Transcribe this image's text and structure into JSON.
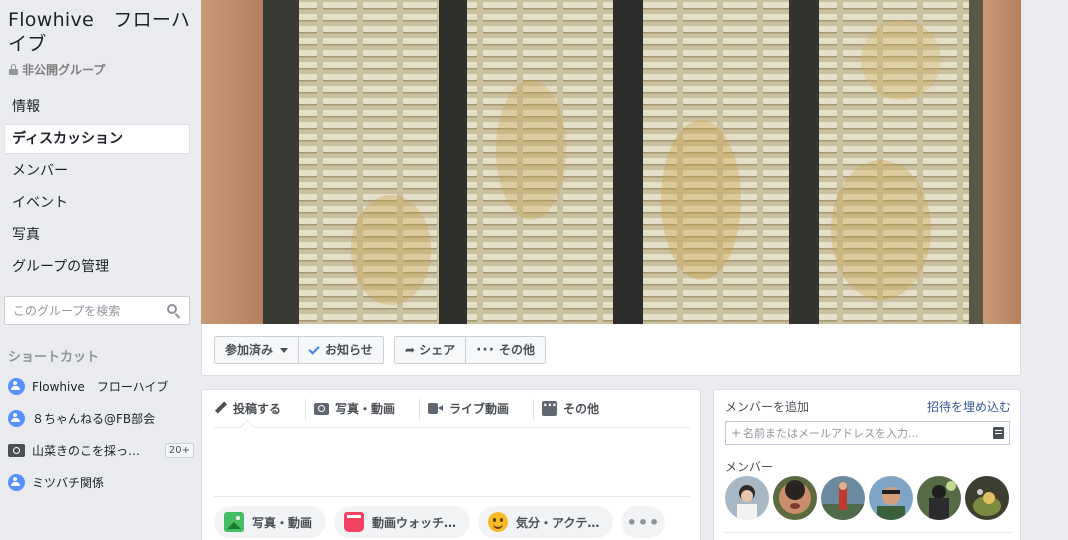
{
  "group": {
    "title": "Flowhive　フローハイブ",
    "privacy": "非公開グループ"
  },
  "nav": {
    "items": [
      {
        "label": "情報"
      },
      {
        "label": "ディスカッション"
      },
      {
        "label": "メンバー"
      },
      {
        "label": "イベント"
      },
      {
        "label": "写真"
      },
      {
        "label": "グループの管理"
      }
    ]
  },
  "search": {
    "placeholder": "このグループを検索"
  },
  "shortcuts": {
    "title": "ショートカット",
    "items": [
      {
        "label": "Flowhive　フローハイブ",
        "icon": "group-icon"
      },
      {
        "label": "８ちゃんねる@FB部会",
        "icon": "group-icon"
      },
      {
        "label": "山菜きのこを採っ…",
        "icon": "camera-icon",
        "badge": "20+"
      },
      {
        "label": "ミツバチ関係",
        "icon": "group-icon"
      }
    ]
  },
  "actions": {
    "joined": "参加済み",
    "notifications": "お知らせ",
    "share": "シェア",
    "more": "その他"
  },
  "composer": {
    "tabs": [
      {
        "label": "投稿する"
      },
      {
        "label": "写真・動画"
      },
      {
        "label": "ライブ動画"
      },
      {
        "label": "その他"
      }
    ],
    "buttons": [
      {
        "label": "写真・動画"
      },
      {
        "label": "動画ウォッチ…"
      },
      {
        "label": "気分・アクテ…"
      }
    ],
    "more": "•••"
  },
  "members_card": {
    "add_label": "メンバーを追加",
    "invite_link": "招待を埋め込む",
    "input_placeholder": "名前またはメールアドレスを入力...",
    "members_label": "メンバー"
  },
  "colors": {
    "link": "#365899",
    "accent": "#4080ff",
    "page_bg": "#e9ebee"
  }
}
